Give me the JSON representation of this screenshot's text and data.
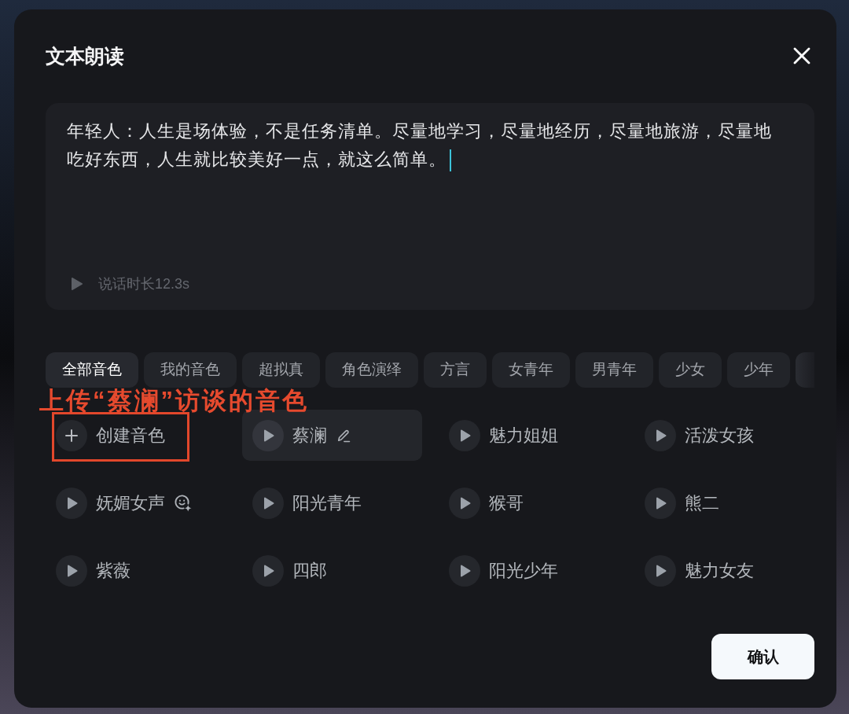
{
  "dialog": {
    "title": "文本朗读"
  },
  "script": {
    "text": "年轻人：人生是场体验，不是任务清单。尽量地学习，尽量地经历，尽量地旅游，尽量地吃好东西，人生就比较美好一点，就这么简单。",
    "focused": true,
    "duration": "说话时长12.3s"
  },
  "tabs": [
    {
      "label": "全部音色",
      "selected": true
    },
    {
      "label": "我的音色",
      "selected": false
    },
    {
      "label": "超拟真",
      "selected": false
    },
    {
      "label": "角色演绎",
      "selected": false
    },
    {
      "label": "方言",
      "selected": false
    },
    {
      "label": "女青年",
      "selected": false
    },
    {
      "label": "男青年",
      "selected": false
    },
    {
      "label": "少女",
      "selected": false
    },
    {
      "label": "少年",
      "selected": false
    }
  ],
  "tabs_overflow": true,
  "annotation": {
    "text": "上传“蔡澜”访谈的音色"
  },
  "create_voice": {
    "label": "创建音色"
  },
  "voices": [
    {
      "name": "蔡澜",
      "selected": true,
      "editable": true,
      "expressive": false
    },
    {
      "name": "魅力姐姐",
      "selected": false,
      "editable": false,
      "expressive": false
    },
    {
      "name": "活泼女孩",
      "selected": false,
      "editable": false,
      "expressive": false
    },
    {
      "name": "妩媚女声",
      "selected": false,
      "editable": false,
      "expressive": true
    },
    {
      "name": "阳光青年",
      "selected": false,
      "editable": false,
      "expressive": false
    },
    {
      "name": "猴哥",
      "selected": false,
      "editable": false,
      "expressive": false
    },
    {
      "name": "熊二",
      "selected": false,
      "editable": false,
      "expressive": false
    },
    {
      "name": "紫薇",
      "selected": false,
      "editable": false,
      "expressive": false
    },
    {
      "name": "四郎",
      "selected": false,
      "editable": false,
      "expressive": false
    },
    {
      "name": "阳光少年",
      "selected": false,
      "editable": false,
      "expressive": false
    },
    {
      "name": "魅力女友",
      "selected": false,
      "editable": false,
      "expressive": false
    }
  ],
  "confirm_button": {
    "label": "确认"
  }
}
